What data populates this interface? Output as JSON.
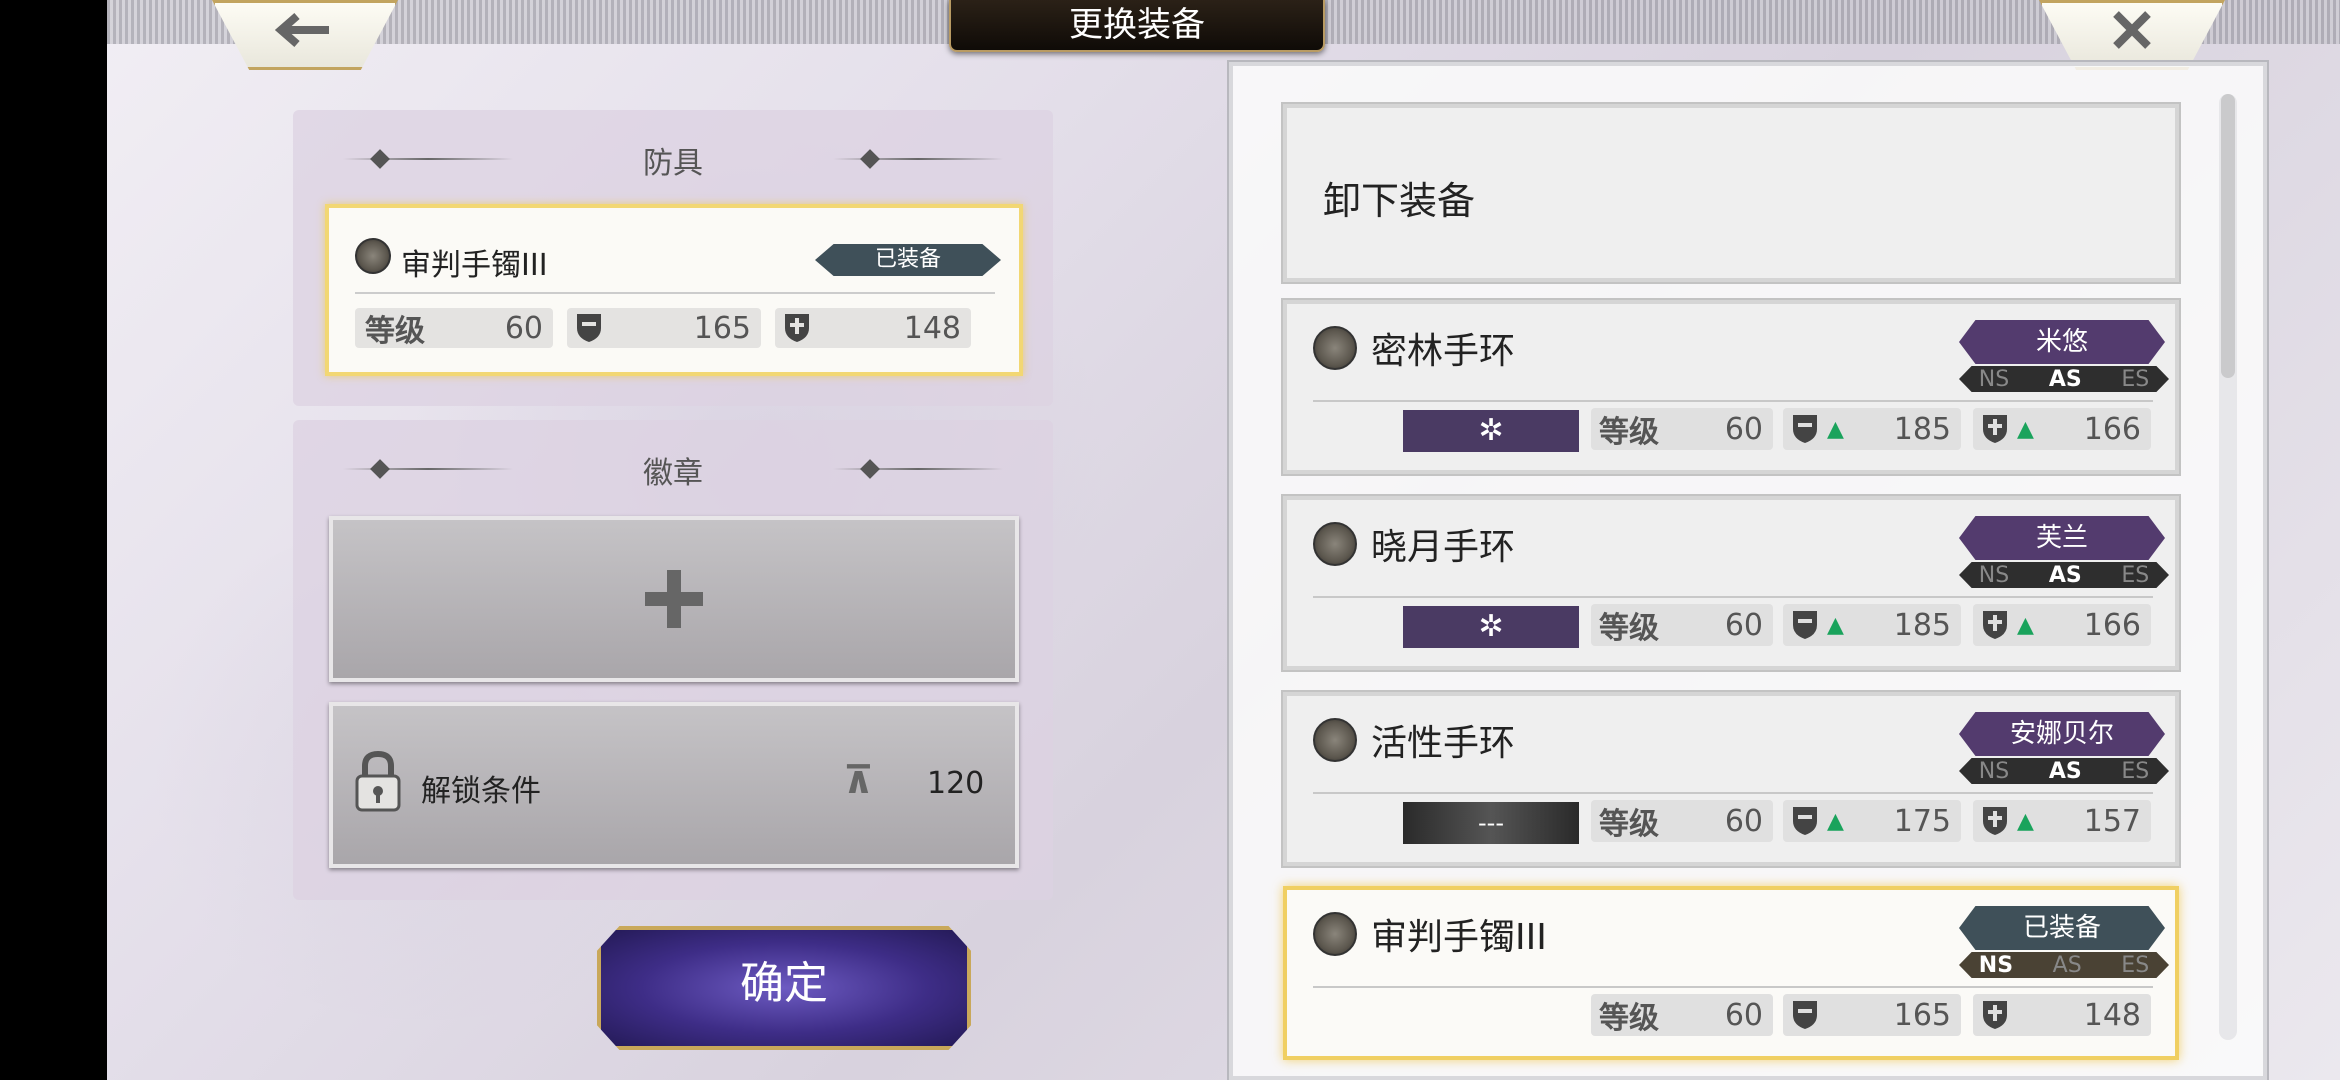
{
  "header": {
    "title": "更换装备"
  },
  "armor_section": {
    "heading": "防具",
    "equipped": {
      "name": "审判手镯III",
      "badge": "已装备",
      "level_label": "等级",
      "level": "60",
      "def": "165",
      "res": "148"
    }
  },
  "medal_section": {
    "heading": "徽章",
    "add_icon": "plus-icon",
    "unlock_label": "解锁条件",
    "unlock_value": "120"
  },
  "confirm_label": "确定",
  "list": {
    "unequip_label": "卸下装备",
    "modes": [
      "NS",
      "AS",
      "ES"
    ],
    "items": [
      {
        "name": "密林手环",
        "owner": "米悠",
        "active_mode": "AS",
        "skill": "✲",
        "level_label": "等级",
        "level": "60",
        "def": "185",
        "res": "166",
        "def_up": "▲",
        "res_up": "▲"
      },
      {
        "name": "晓月手环",
        "owner": "芙兰",
        "active_mode": "AS",
        "skill": "✲",
        "level_label": "等级",
        "level": "60",
        "def": "185",
        "res": "166",
        "def_up": "▲",
        "res_up": "▲"
      },
      {
        "name": "活性手环",
        "owner": "安娜贝尔",
        "active_mode": "AS",
        "skill": "---",
        "level_label": "等级",
        "level": "60",
        "def": "175",
        "res": "157",
        "def_up": "▲",
        "res_up": "▲"
      },
      {
        "name": "审判手镯III",
        "owner": "已装备",
        "active_mode": "NS",
        "skill": "",
        "level_label": "等级",
        "level": "60",
        "def": "165",
        "res": "148",
        "def_up": "",
        "res_up": ""
      }
    ]
  },
  "colors": {
    "gold_border": "#f2d773",
    "purple_tag": "#533b6e",
    "equipped_tag": "#3f5059",
    "up_arrow": "#1aa35c"
  }
}
